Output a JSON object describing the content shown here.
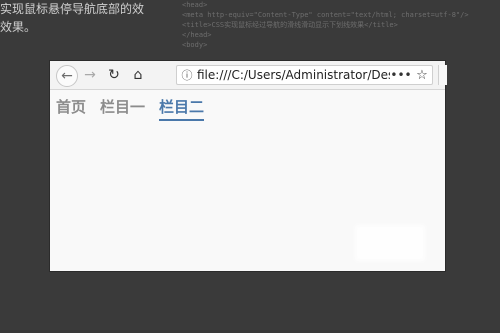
{
  "background": {
    "left_text": [
      "实现鼠标悬停导航底部的效",
      "效果。"
    ],
    "code_lines": [
      "<head>",
      "<meta http-equiv=\"Content-Type\" content=\"text/html; charset=utf-8\"/>",
      "<title>CSS实现鼠标经过导航的滑线滑动显示下划线效果</title>",
      "</head>",
      "",
      "<body>"
    ]
  },
  "browser": {
    "url": "file:///C:/Users/Administrator/Des"
  },
  "nav": {
    "items": [
      "首页",
      "栏目一",
      "栏目二"
    ],
    "active_index": 2,
    "colors": {
      "inactive": "#8c8c8c",
      "active": "#4a78aa"
    }
  },
  "icons": {
    "back": "back-arrow-icon",
    "forward": "forward-arrow-icon",
    "reload": "reload-icon",
    "home": "home-icon",
    "info": "info-icon",
    "more": "more-dots-icon",
    "bookmark": "bookmark-star-icon"
  }
}
